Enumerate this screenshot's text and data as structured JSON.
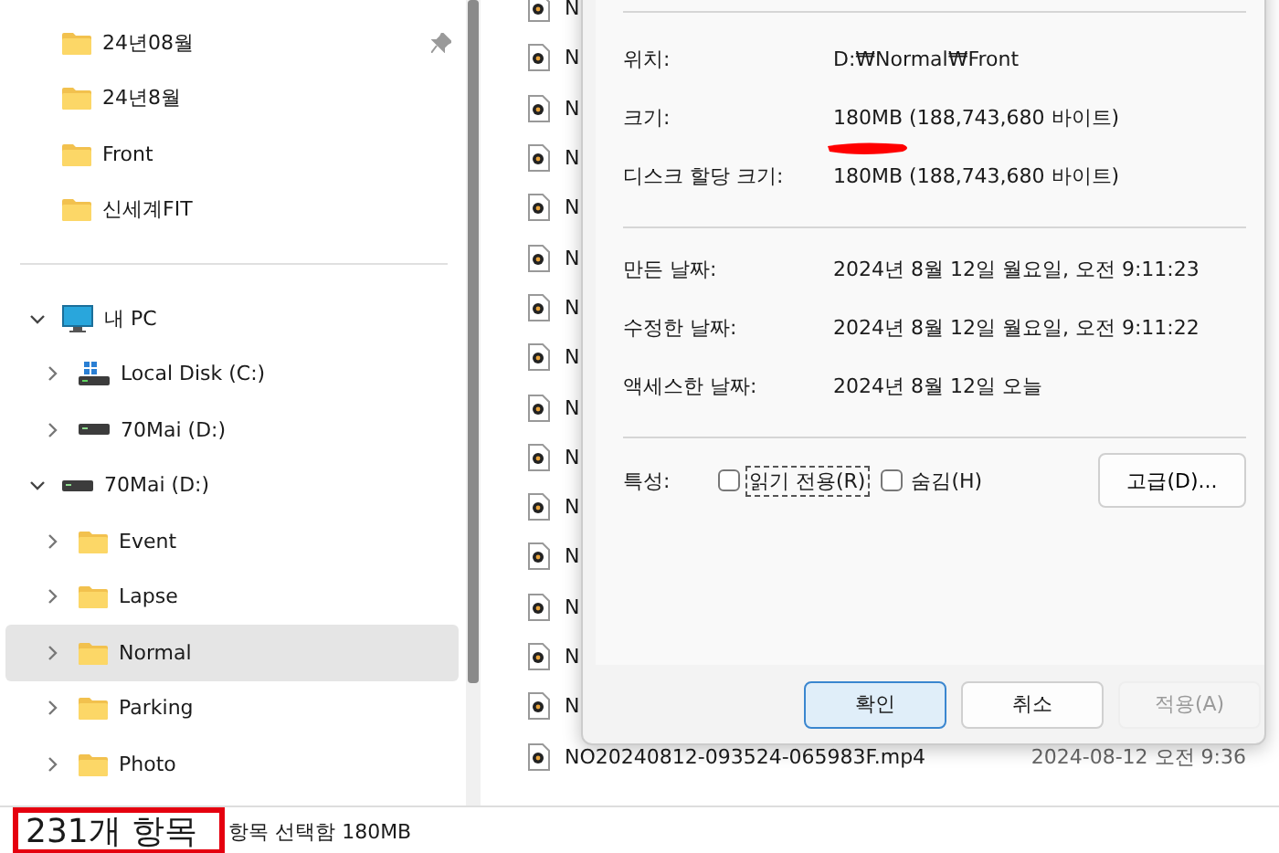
{
  "quick_access": [
    {
      "label": "24년08월",
      "pinned": true
    },
    {
      "label": "24년8월",
      "pinned": false
    },
    {
      "label": "Front",
      "pinned": false
    },
    {
      "label": "신세계FIT",
      "pinned": false
    }
  ],
  "tree": [
    {
      "label": "내 PC",
      "kind": "pc",
      "expanded": true,
      "selected": false,
      "children": [
        {
          "label": "Local Disk (C:)",
          "kind": "system-drive",
          "expanded": false,
          "selected": false
        },
        {
          "label": "70Mai (D:)",
          "kind": "drive",
          "expanded": false,
          "selected": false
        }
      ]
    },
    {
      "label": "70Mai (D:)",
      "kind": "drive",
      "expanded": true,
      "selected": false,
      "children": [
        {
          "label": "Event",
          "kind": "folder",
          "expanded": false,
          "selected": false
        },
        {
          "label": "Lapse",
          "kind": "folder",
          "expanded": false,
          "selected": false
        },
        {
          "label": "Normal",
          "kind": "folder",
          "expanded": false,
          "selected": true
        },
        {
          "label": "Parking",
          "kind": "folder",
          "expanded": false,
          "selected": false
        },
        {
          "label": "Photo",
          "kind": "folder",
          "expanded": false,
          "selected": false
        }
      ]
    }
  ],
  "files": [
    {
      "name": "N"
    },
    {
      "name": "N"
    },
    {
      "name": "N"
    },
    {
      "name": "N"
    },
    {
      "name": "N"
    },
    {
      "name": "N"
    },
    {
      "name": "N"
    },
    {
      "name": "N"
    },
    {
      "name": "N"
    },
    {
      "name": "N"
    },
    {
      "name": "N"
    },
    {
      "name": "N"
    },
    {
      "name": "N"
    },
    {
      "name": "N"
    },
    {
      "name": "N"
    },
    {
      "name": "NO20240812-093524-065983F.mp4",
      "modified": "2024-08-12 오전 9:36"
    }
  ],
  "properties": {
    "general": [
      {
        "label": "위치:",
        "value": "D:₩Normal₩Front"
      },
      {
        "label": "크기:",
        "value": "180MB (188,743,680 바이트)"
      },
      {
        "label": "디스크 할당 크기:",
        "value": "180MB (188,743,680 바이트)"
      }
    ],
    "dates": [
      {
        "label": "만든 날짜:",
        "value": "2024년 8월 12일 월요일, 오전 9:11:23"
      },
      {
        "label": "수정한 날짜:",
        "value": "2024년 8월 12일 월요일, 오전 9:11:22"
      },
      {
        "label": "액세스한 날짜:",
        "value": "2024년 8월 12일 오늘"
      }
    ],
    "attributes_label": "특성:",
    "attributes": [
      {
        "label": "읽기 전용(R)",
        "checked": false,
        "focused": true
      },
      {
        "label": "숨김(H)",
        "checked": false,
        "focused": false
      }
    ],
    "advanced_button": "고급(D)...",
    "buttons": [
      {
        "label": "확인",
        "default": true,
        "disabled": false
      },
      {
        "label": "취소",
        "default": false,
        "disabled": false
      },
      {
        "label": "적용(A)",
        "default": false,
        "disabled": true
      }
    ]
  },
  "status_bar": {
    "item_count": "231개 항목",
    "selection": "항목 선택함 180MB"
  }
}
